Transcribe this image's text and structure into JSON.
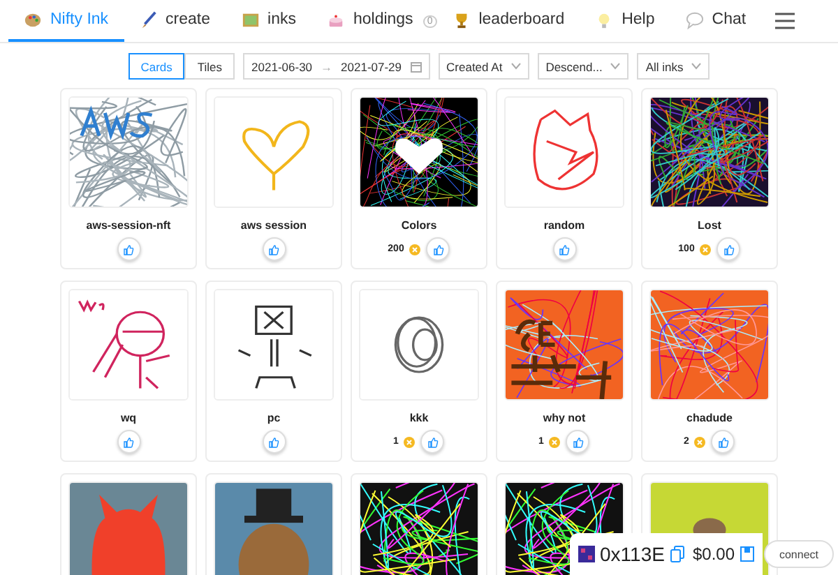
{
  "nav": {
    "items": [
      {
        "label": "Nifty Ink",
        "selected": true
      },
      {
        "label": "create",
        "selected": false
      },
      {
        "label": "inks",
        "selected": false
      },
      {
        "label": "holdings",
        "badge": "0",
        "selected": false
      },
      {
        "label": "leaderboard",
        "selected": false
      },
      {
        "label": "Help",
        "selected": false
      },
      {
        "label": "Chat",
        "selected": false
      }
    ]
  },
  "toolbar": {
    "views": [
      {
        "label": "Cards",
        "selected": true
      },
      {
        "label": "Tiles",
        "selected": false
      }
    ],
    "date_from": "2021-06-30",
    "date_separator": "→",
    "date_to": "2021-07-29",
    "sort_field": "Created At",
    "sort_order": "Descend...",
    "filter": "All inks"
  },
  "cards": [
    {
      "kind": "full",
      "name": "aws-session-nft"
    },
    {
      "kind": "full",
      "name": "aws session"
    },
    {
      "kind": "full",
      "name": "Colors",
      "price": "200"
    },
    {
      "kind": "full",
      "name": "random"
    },
    {
      "kind": "full",
      "name": "Lost",
      "price": "100"
    },
    {
      "kind": "full",
      "name": "wq"
    },
    {
      "kind": "full",
      "name": "pc"
    },
    {
      "kind": "full",
      "name": "kkk",
      "price": "1"
    },
    {
      "kind": "full",
      "name": "why not",
      "price": "1"
    },
    {
      "kind": "full",
      "name": "chadude",
      "price": "2"
    },
    {
      "kind": "partial"
    },
    {
      "kind": "partial"
    },
    {
      "kind": "partial"
    },
    {
      "kind": "partial"
    },
    {
      "kind": "partial"
    }
  ],
  "wallet": {
    "address": "0x113E",
    "balance": "$0.00",
    "connect": "connect"
  }
}
